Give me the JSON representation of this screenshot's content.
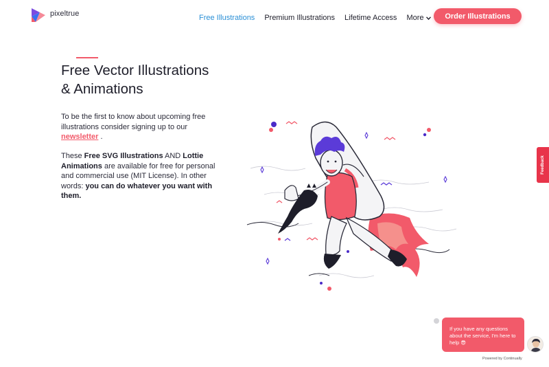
{
  "header": {
    "logo_text": "pixeltrue",
    "nav": [
      {
        "label": "Free Illustrations",
        "active": true
      },
      {
        "label": "Premium Illustrations",
        "active": false
      },
      {
        "label": "Lifetime Access",
        "active": false
      },
      {
        "label": "More",
        "active": false
      }
    ],
    "order_button": "Order Illustrations"
  },
  "hero": {
    "title_line1": "Free Vector Illustrations",
    "title_line2": "& Animations",
    "p1_text": "To be the first to know about upcoming free illustrations consider signing up to our ",
    "p1_link": "newsletter",
    "p1_end": " .",
    "p2_a": "These ",
    "p2_b": "Free SVG Illustrations",
    "p2_c": " AND ",
    "p2_d": "Lottie Animations",
    "p2_e": " are available for free for personal and commercial use (MIT License). In other words: ",
    "p2_f": "you can do whatever you want with them."
  },
  "feedback": {
    "label": "Feedback"
  },
  "chat": {
    "message": "If you have any questions about the service, I'm here to help 😎",
    "powered": "Powered by Continually"
  },
  "colors": {
    "accent": "#f25a6a",
    "nav_active": "#2a8fd6",
    "hair": "#5b3bd8",
    "feedback": "#e8344a"
  },
  "icons": {
    "logo": "pixeltrue-logo-icon",
    "more": "chevron-down-icon",
    "close": "close-icon"
  }
}
